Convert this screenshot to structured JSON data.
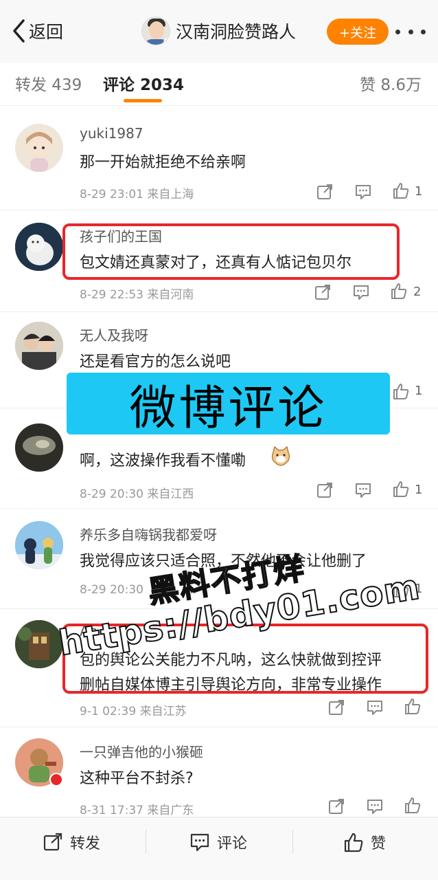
{
  "nav": {
    "back_label": "返回",
    "title": "汉南洞脸赞路人",
    "follow_label": "+关注"
  },
  "tabs": {
    "repost": "转发 439",
    "comment": "评论 2034",
    "like": "赞 8.6万"
  },
  "comments": [
    {
      "user": "yuki1987",
      "text": "那一开始就拒绝不给亲啊",
      "meta": "8-29 23:01 来自上海",
      "likes": "1"
    },
    {
      "user": "孩子们的王国",
      "text": "包文婧还真蒙对了，还真有人惦记包贝尔",
      "meta": "8-29 22:53 来自河南",
      "likes": "2"
    },
    {
      "user": "无人及我呀",
      "text": "还是看官方的怎么说吧",
      "meta": "",
      "likes": "1"
    },
    {
      "user": "",
      "text": "啊，这波操作我看不懂嘞",
      "meta": "8-29 20:30 来自江西",
      "likes": "1"
    },
    {
      "user": "养乐多自嗨锅我都爱呀",
      "text": "我觉得应该只适合照，不然他不会让他删了",
      "meta": "8-29 20:30",
      "likes": "1"
    },
    {
      "user": "An",
      "text_line1": "包的舆论公关能力不凡呐，这么快就做到控评",
      "text_line2": "删帖自媒体博主引导舆论方向，非常专业操作",
      "meta": "9-1 02:39 来自江苏",
      "likes": ""
    },
    {
      "user": "一只弹吉他的小猴砸",
      "text": "这种平台不封杀?",
      "meta": "8-31 17:37 来自广东",
      "likes": ""
    }
  ],
  "banner_text": "微博评论",
  "watermark": {
    "line1": "黑料不打烊",
    "line2": "https://bdy01.com"
  },
  "bottom_bar": {
    "repost": "转发",
    "comment": "评论",
    "like": "赞"
  },
  "colors": {
    "accent": "#ff8200",
    "highlight": "#e8262a",
    "banner": "#1ec8f5"
  }
}
